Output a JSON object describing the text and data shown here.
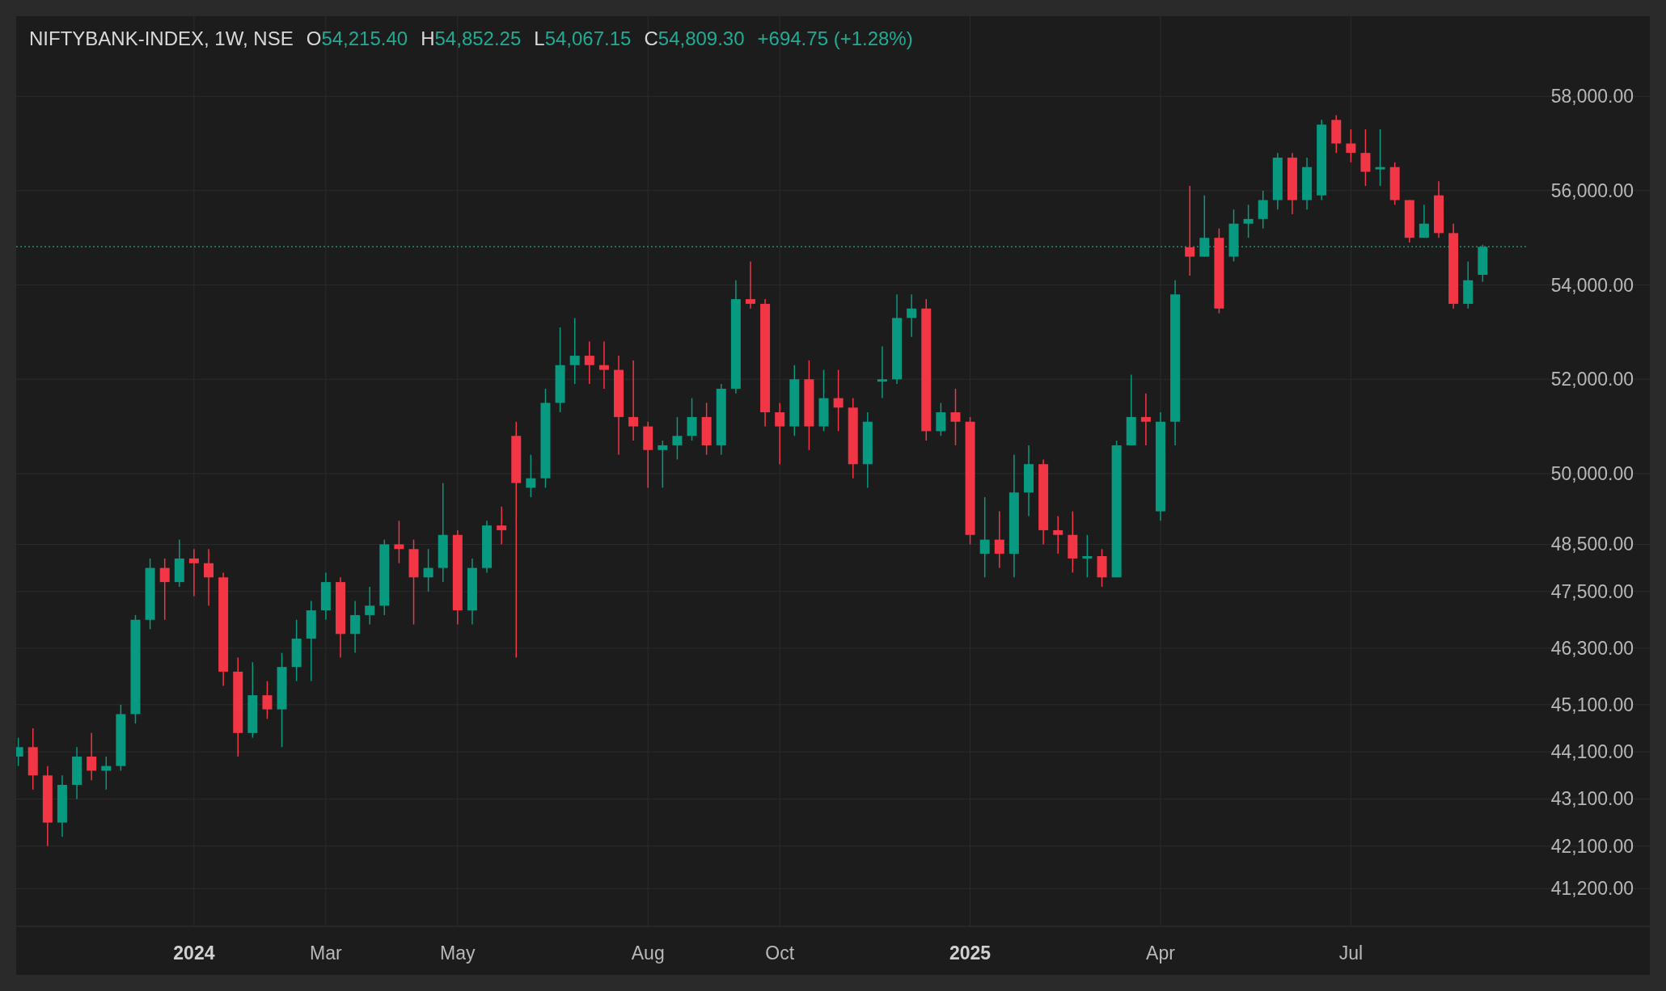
{
  "legend": {
    "symbol": "NIFTYBANK-INDEX, 1W, NSE",
    "values": [
      {
        "label": "O",
        "value": "54,215.40"
      },
      {
        "label": "H",
        "value": "54,852.25"
      },
      {
        "label": "L",
        "value": "54,067.15"
      },
      {
        "label": "C",
        "value": "54,809.30"
      }
    ],
    "change": "+694.75 (+1.28%)"
  },
  "time_axis": {
    "labels": [
      {
        "kind": "year"
      },
      {
        "kind": "month"
      },
      {
        "kind": "month"
      },
      {
        "kind": "month"
      },
      {
        "kind": "month"
      },
      {
        "kind": "year"
      },
      {
        "kind": "month"
      },
      {
        "kind": "month"
      }
    ]
  },
  "chart_data": {
    "type": "candlestick",
    "ylim": [
      40400,
      59700
    ],
    "grid": true,
    "ref_lines": [
      {
        "axis": "y",
        "value": 54809.3,
        "color": "#089981"
      }
    ],
    "categories": [
      null,
      null,
      null,
      null,
      null,
      null,
      null,
      null,
      null,
      null,
      null,
      null,
      "2024",
      null,
      null,
      null,
      null,
      null,
      null,
      null,
      null,
      "Mar",
      null,
      null,
      null,
      null,
      null,
      null,
      null,
      null,
      "May",
      null,
      null,
      null,
      null,
      null,
      null,
      null,
      null,
      null,
      null,
      null,
      null,
      "Aug",
      null,
      null,
      null,
      null,
      null,
      null,
      null,
      null,
      "Oct",
      null,
      null,
      null,
      null,
      null,
      null,
      null,
      null,
      null,
      null,
      null,
      null,
      "2025",
      null,
      null,
      null,
      null,
      null,
      null,
      null,
      null,
      null,
      null,
      null,
      null,
      "Apr",
      null,
      null,
      null,
      null,
      null,
      null,
      null,
      null,
      null,
      null,
      null,
      null,
      "Jul",
      null,
      null,
      null,
      null,
      null,
      null,
      null,
      null,
      null
    ],
    "ohlc": [
      [
        44000,
        44400,
        43800,
        44200
      ],
      [
        44200,
        44600,
        43300,
        43600
      ],
      [
        43600,
        43800,
        42100,
        42600
      ],
      [
        42600,
        43600,
        42300,
        43400
      ],
      [
        43400,
        44200,
        43100,
        44000
      ],
      [
        44000,
        44500,
        43500,
        43700
      ],
      [
        43700,
        44000,
        43300,
        43800
      ],
      [
        43800,
        45100,
        43700,
        44900
      ],
      [
        44900,
        47000,
        44700,
        46900
      ],
      [
        46900,
        48200,
        46700,
        48000
      ],
      [
        48000,
        48200,
        46900,
        47700
      ],
      [
        47700,
        48600,
        47600,
        48200
      ],
      [
        48200,
        48400,
        47400,
        48100
      ],
      [
        48100,
        48400,
        47200,
        47800
      ],
      [
        47800,
        47900,
        45500,
        45800
      ],
      [
        45800,
        46100,
        44000,
        44500
      ],
      [
        44500,
        46000,
        44400,
        45300
      ],
      [
        45300,
        45600,
        44800,
        45000
      ],
      [
        45000,
        46200,
        44200,
        45900
      ],
      [
        45900,
        46900,
        45600,
        46500
      ],
      [
        46500,
        47300,
        45600,
        47100
      ],
      [
        47100,
        47900,
        46900,
        47700
      ],
      [
        47700,
        47800,
        46100,
        46600
      ],
      [
        46600,
        47300,
        46200,
        47000
      ],
      [
        47000,
        47600,
        46800,
        47200
      ],
      [
        47200,
        48600,
        47000,
        48500
      ],
      [
        48500,
        49000,
        48100,
        48400
      ],
      [
        48400,
        48600,
        46800,
        47800
      ],
      [
        47800,
        48400,
        47500,
        48000
      ],
      [
        48000,
        49800,
        47700,
        48700
      ],
      [
        48700,
        48800,
        46800,
        47100
      ],
      [
        47100,
        48200,
        46800,
        48000
      ],
      [
        48000,
        49000,
        47900,
        48900
      ],
      [
        48900,
        49300,
        48500,
        48800
      ],
      [
        50800,
        51100,
        46100,
        49800
      ],
      [
        49700,
        50400,
        49500,
        49900
      ],
      [
        49900,
        51800,
        49700,
        51500
      ],
      [
        51500,
        53100,
        51300,
        52300
      ],
      [
        52300,
        53300,
        51900,
        52500
      ],
      [
        52500,
        52800,
        51900,
        52300
      ],
      [
        52300,
        52800,
        51800,
        52200
      ],
      [
        52200,
        52500,
        50400,
        51200
      ],
      [
        51200,
        52400,
        50700,
        51000
      ],
      [
        51000,
        51100,
        49700,
        50500
      ],
      [
        50500,
        50700,
        49700,
        50600
      ],
      [
        50600,
        51200,
        50300,
        50800
      ],
      [
        50800,
        51600,
        50700,
        51200
      ],
      [
        51200,
        51500,
        50400,
        50600
      ],
      [
        50600,
        51900,
        50400,
        51800
      ],
      [
        51800,
        54100,
        51700,
        53700
      ],
      [
        53700,
        54500,
        53500,
        53600
      ],
      [
        53600,
        53700,
        51000,
        51300
      ],
      [
        51300,
        51500,
        50200,
        51000
      ],
      [
        51000,
        52300,
        50800,
        52000
      ],
      [
        52000,
        52400,
        50500,
        51000
      ],
      [
        51000,
        52200,
        50900,
        51600
      ],
      [
        51600,
        52200,
        50900,
        51400
      ],
      [
        51400,
        51600,
        49900,
        50200
      ],
      [
        50200,
        51300,
        49700,
        51100
      ],
      [
        51950,
        52700,
        51600,
        52000
      ],
      [
        52000,
        53800,
        51900,
        53300
      ],
      [
        53300,
        53800,
        52900,
        53500
      ],
      [
        53500,
        53700,
        50700,
        50900
      ],
      [
        50900,
        51500,
        50800,
        51300
      ],
      [
        51300,
        51800,
        50600,
        51100
      ],
      [
        51100,
        51200,
        48500,
        48700
      ],
      [
        48300,
        49500,
        47800,
        48600
      ],
      [
        48600,
        49200,
        48000,
        48300
      ],
      [
        48300,
        50400,
        47800,
        49600
      ],
      [
        49600,
        50600,
        49100,
        50200
      ],
      [
        50200,
        50300,
        48500,
        48800
      ],
      [
        48800,
        49100,
        48300,
        48700
      ],
      [
        48700,
        49200,
        47900,
        48200
      ],
      [
        48200,
        48700,
        47800,
        48250
      ],
      [
        48250,
        48400,
        47600,
        47800
      ],
      [
        47800,
        50700,
        47800,
        50600
      ],
      [
        50600,
        52100,
        50600,
        51200
      ],
      [
        51200,
        51700,
        50600,
        51100
      ],
      [
        49200,
        51300,
        49000,
        51100
      ],
      [
        51100,
        54100,
        50600,
        53800
      ],
      [
        54800,
        56100,
        54200,
        54600
      ],
      [
        54600,
        55900,
        54600,
        55000
      ],
      [
        55000,
        55200,
        53400,
        53500
      ],
      [
        54600,
        55600,
        54500,
        55300
      ],
      [
        55300,
        55700,
        55000,
        55400
      ],
      [
        55400,
        56000,
        55200,
        55800
      ],
      [
        55800,
        56800,
        55600,
        56700
      ],
      [
        56700,
        56800,
        55500,
        55800
      ],
      [
        55800,
        56700,
        55600,
        56500
      ],
      [
        55900,
        57500,
        55800,
        57400
      ],
      [
        57500,
        57600,
        56800,
        57000
      ],
      [
        57000,
        57300,
        56600,
        56800
      ],
      [
        56800,
        57300,
        56100,
        56400
      ],
      [
        56450,
        57300,
        56100,
        56500
      ],
      [
        56500,
        56600,
        55700,
        55800
      ],
      [
        55800,
        55800,
        54900,
        55000
      ],
      [
        55000,
        55700,
        55000,
        55300
      ],
      [
        55900,
        56200,
        55000,
        55100
      ],
      [
        55100,
        55300,
        53500,
        53600
      ],
      [
        53600,
        54500,
        53500,
        54100
      ],
      [
        54215.4,
        54852.25,
        54067.15,
        54809.3
      ]
    ],
    "yticks": [
      {
        "value": 58000,
        "label": "58,000.00"
      },
      {
        "value": 56000,
        "label": "56,000.00"
      },
      {
        "value": 54000,
        "label": "54,000.00"
      },
      {
        "value": 52000,
        "label": "52,000.00"
      },
      {
        "value": 50000,
        "label": "50,000.00"
      },
      {
        "value": 48500,
        "label": "48,500.00"
      },
      {
        "value": 47500,
        "label": "47,500.00"
      },
      {
        "value": 46300,
        "label": "46,300.00"
      },
      {
        "value": 45100,
        "label": "45,100.00"
      },
      {
        "value": 44100,
        "label": "44,100.00"
      },
      {
        "value": 43100,
        "label": "43,100.00"
      },
      {
        "value": 42100,
        "label": "42,100.00"
      },
      {
        "value": 41200,
        "label": "41,200.00"
      }
    ]
  }
}
